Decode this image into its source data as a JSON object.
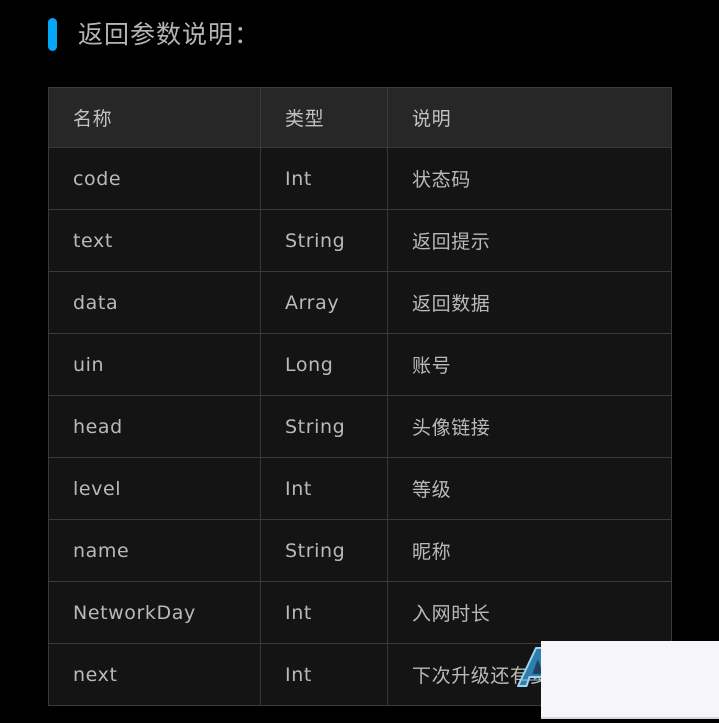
{
  "section": {
    "title": "返回参数说明：",
    "accent_color": "#04a7f5",
    "title_color": "#b4b4b4"
  },
  "table": {
    "header_background": "#272727",
    "row_background": "#141414",
    "border_color": "#3a3a3a",
    "columns": [
      {
        "key": "name",
        "label": "名称"
      },
      {
        "key": "type",
        "label": "类型"
      },
      {
        "key": "desc",
        "label": "说明"
      }
    ],
    "rows": [
      {
        "name": "code",
        "type": "Int",
        "desc": "状态码"
      },
      {
        "name": "text",
        "type": "String",
        "desc": "返回提示"
      },
      {
        "name": "data",
        "type": "Array",
        "desc": "返回数据"
      },
      {
        "name": "uin",
        "type": "Long",
        "desc": "账号"
      },
      {
        "name": "head",
        "type": "String",
        "desc": "头像链接"
      },
      {
        "name": "level",
        "type": "Int",
        "desc": "等级"
      },
      {
        "name": "name",
        "type": "String",
        "desc": "昵称"
      },
      {
        "name": "NetworkDay",
        "type": "Int",
        "desc": "入网时长"
      },
      {
        "name": "next",
        "type": "Int",
        "desc": "下次升级还有多"
      }
    ]
  },
  "overlay": {
    "panel_color": "#f6f6f8",
    "watermark": "A"
  }
}
